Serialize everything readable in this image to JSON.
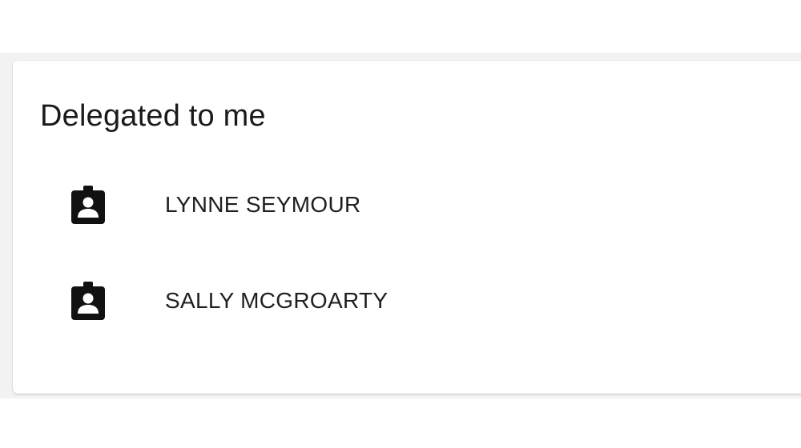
{
  "card": {
    "title": "Delegated to me"
  },
  "delegates": [
    {
      "name": "LYNNE SEYMOUR",
      "icon": "badge-person-icon"
    },
    {
      "name": "SALLY MCGROARTY",
      "icon": "badge-person-icon"
    }
  ],
  "colors": {
    "background": "#ffffff",
    "band": "#f2f2f2",
    "card": "#ffffff",
    "text": "#1f1f1f",
    "icon": "#111111"
  }
}
